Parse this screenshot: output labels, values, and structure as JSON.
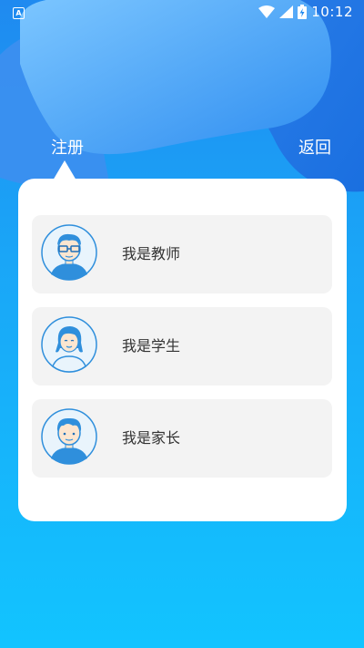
{
  "status_bar": {
    "time": "10:12",
    "icons": [
      "app-notification-icon",
      "wifi-icon",
      "cell-signal-icon",
      "battery-charging-icon"
    ]
  },
  "header": {
    "title": "注册",
    "back_label": "返回"
  },
  "roles": [
    {
      "label": "我是教师",
      "icon": "teacher-avatar-icon"
    },
    {
      "label": "我是学生",
      "icon": "student-avatar-icon"
    },
    {
      "label": "我是家长",
      "icon": "parent-avatar-icon"
    }
  ],
  "colors": {
    "background_top": "#1f8af0",
    "background_bottom": "#12c4ff",
    "card": "#ffffff",
    "item_background": "#f3f3f3",
    "avatar_accent": "#2f8fdc",
    "text": "#333333"
  }
}
